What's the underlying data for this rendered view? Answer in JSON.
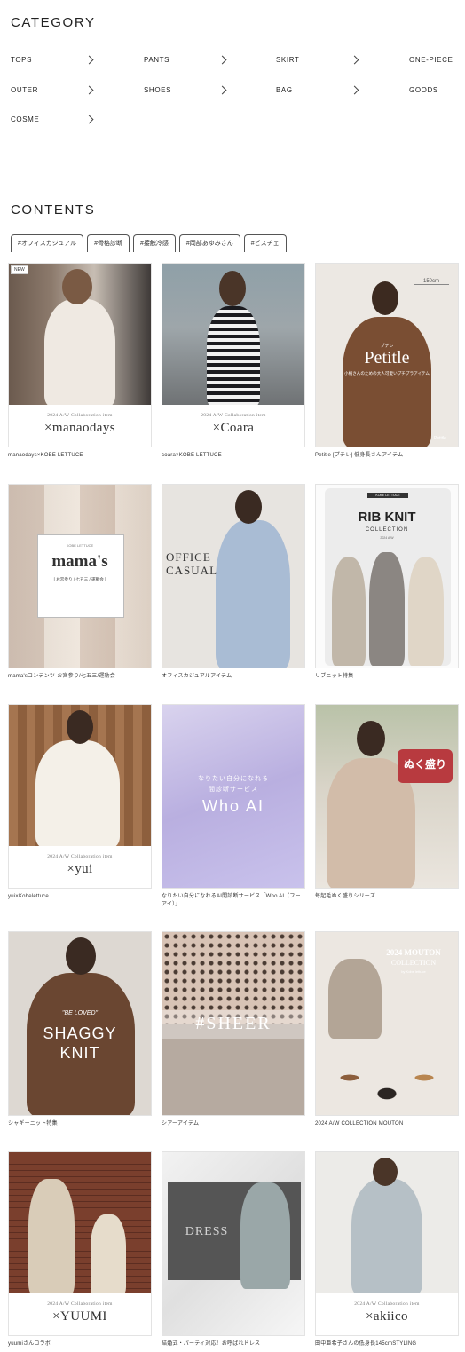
{
  "category": {
    "title": "CATEGORY",
    "items": [
      "TOPS",
      "PANTS",
      "SKIRT",
      "ONE-PIECE",
      "OUTER",
      "SHOES",
      "BAG",
      "GOODS",
      "COSME"
    ]
  },
  "contents": {
    "title": "CONTENTS",
    "tags": [
      "#オフィスカジュアル",
      "#骨格診断",
      "#接触冷感",
      "#岡部あゆみさん",
      "#ビスチェ"
    ],
    "cards": [
      {
        "caption": "manaodays×KOBE LETTUCE",
        "badge": "NEW",
        "sub": "2024 A/W Collaboration item",
        "main": "×manaodays"
      },
      {
        "caption": "coara×KOBE LETTUCE",
        "sub": "2024 A/W Collaboration item",
        "main": "×Coara"
      },
      {
        "caption": "Petitle [プチレ] 低身長さんアイテム",
        "title": "Petitle",
        "kana": "プチレ",
        "tagline": "小柄さんのための大人可愛いプチプラアイテム",
        "height": "150cm",
        "logo": "Petitle"
      },
      {
        "caption": "mama'sコンテンツ-お宮参り/七五三/運動会",
        "brand": "KOBE LETTUCE",
        "title": "mama's",
        "subtitle": "[ お宮参り / 七五三 / 運動会 ]"
      },
      {
        "caption": "オフィスカジュアルアイテム",
        "title1": "OFFICE",
        "title2": "CASUAL"
      },
      {
        "caption": "リブニット特集",
        "brand": "KOBE LETTUCE",
        "title": "RIB KNIT",
        "subtitle": "COLLECTION",
        "year": "2024 A/W"
      },
      {
        "caption": "yui×Kobelettuce",
        "sub": "2024 A/W Collaboration item",
        "main": "×yui"
      },
      {
        "caption": "なりたい自分になれるAI間診断サービス「Who AI（フーアイ）」",
        "line1": "なりたい自分になれる",
        "line2": "間診断サービス",
        "title": "Who AI"
      },
      {
        "caption": "毎起毛ぬく盛りシリーズ",
        "title": "ぬく盛り"
      },
      {
        "caption": "シャギーニット特集",
        "quote": "\"BE LOVED\"",
        "title1": "SHAGGY",
        "title2": "KNIT"
      },
      {
        "caption": "シアーアイテム",
        "title": "#SHEER"
      },
      {
        "caption": "2024 A/W COLLECTION MOUTON",
        "title1": "2024 MOUTON",
        "title2": "COLLECTION",
        "by": "by Kobe lettuce"
      },
      {
        "caption": "yuumiさんコラボ",
        "sub": "2024 A/W Collaboration item",
        "main": "×YUUMI"
      },
      {
        "caption": "結婚式・パーティ対応！お呼ばれドレス",
        "title": "DRESS"
      },
      {
        "caption": "田中亜希子さんの低身長145cmSTYLING",
        "sub": "2024 A/W Collaboration item",
        "main": "×akiico"
      }
    ]
  }
}
